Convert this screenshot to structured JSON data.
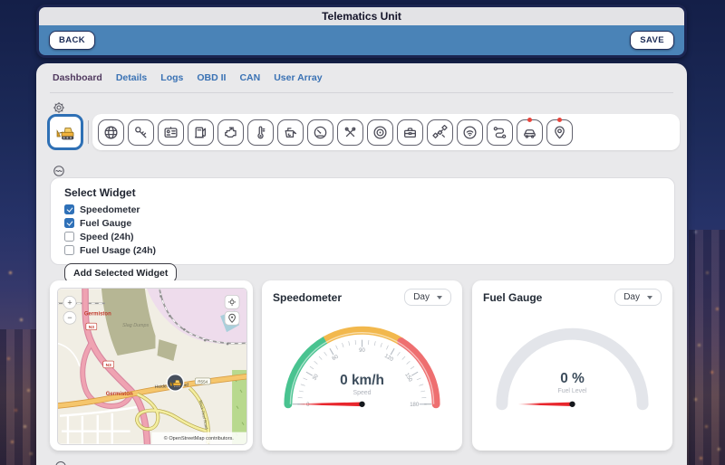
{
  "header": {
    "title": "Telematics Unit",
    "back": "BACK",
    "save": "SAVE",
    "bar_color": "#4a83b7",
    "frame_color": "#1b2450"
  },
  "tabs": [
    {
      "label": "Dashboard",
      "active": true
    },
    {
      "label": "Details",
      "active": false
    },
    {
      "label": "Logs",
      "active": false
    },
    {
      "label": "OBD II",
      "active": false
    },
    {
      "label": "CAN",
      "active": false
    },
    {
      "label": "User Array",
      "active": false
    }
  ],
  "vehicle_bar": {
    "selected_icon": "dump-truck",
    "icons": [
      "globe",
      "key",
      "id-card",
      "fuel-pump",
      "engine",
      "thermometer",
      "oil-can",
      "gauge",
      "no-service",
      "brake-disc",
      "toolbox",
      "satellite",
      "wifi",
      "route",
      "car",
      "location-pin"
    ],
    "badged_icons": [
      "car",
      "location-pin"
    ],
    "badge_color": "#e8453c",
    "selected_border_color": "#2e70b5"
  },
  "widget_panel": {
    "title": "Select Widget",
    "options": [
      {
        "label": "Speedometer",
        "checked": true
      },
      {
        "label": "Fuel Gauge",
        "checked": true
      },
      {
        "label": "Speed (24h)",
        "checked": false
      },
      {
        "label": "Fuel Usage (24h)",
        "checked": false
      }
    ],
    "add_button": "Add Selected Widget",
    "checkbox_color": "#2f71b8"
  },
  "map": {
    "zoom_in": "+",
    "zoom_out": "−",
    "attribution": "© OpenStreetMap contributors.",
    "labels": {
      "town": "Germiston",
      "area": "Slag Dumps",
      "road": "Heidelberg Road",
      "road_ref": "R554",
      "side_road": "Black Reef Road",
      "motorway_ref": "N3"
    }
  },
  "speedometer": {
    "title": "Speedometer",
    "period": "Day",
    "value": "0 km/h",
    "label": "Speed",
    "min": 0,
    "max": 180,
    "needle_value": 0,
    "ticks": [
      "0",
      "30",
      "60",
      "90",
      "120",
      "150",
      "180"
    ],
    "zones": [
      {
        "from": 0,
        "to": 60,
        "color": "#49c390"
      },
      {
        "from": 60,
        "to": 122,
        "color": "#f2b84d"
      },
      {
        "from": 122,
        "to": 180,
        "color": "#ee6f70"
      }
    ],
    "needle_color": "#e8262d"
  },
  "fuel_gauge": {
    "title": "Fuel Gauge",
    "period": "Day",
    "value": "0 %",
    "label": "Fuel Level",
    "min": 0,
    "max": 100,
    "needle_value": 0,
    "arc_color": "#e3e5ea",
    "needle_color": "#e8262d"
  }
}
